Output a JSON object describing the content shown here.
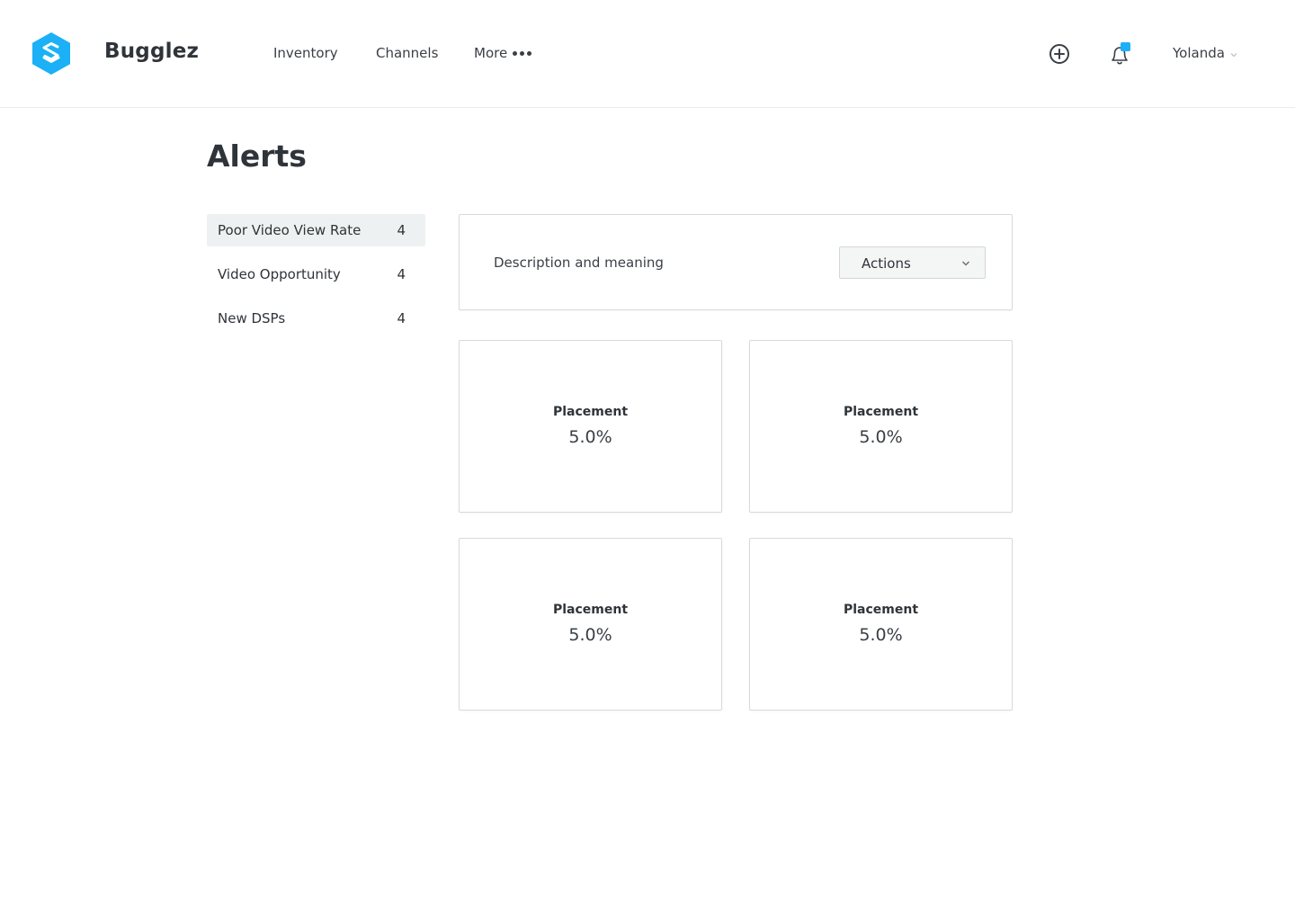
{
  "header": {
    "brand": "Bugglez",
    "nav": {
      "inventory": "Inventory",
      "channels": "Channels",
      "more": "More"
    },
    "user_name": "Yolanda",
    "icons": {
      "logo": "hexagon-logo-icon",
      "add": "plus-circle-icon",
      "notifications": "bell-icon",
      "more": "more-dots-icon",
      "user_menu": "chevron-down-icon"
    },
    "colors": {
      "brand": "#1cb0f6",
      "notification_badge": "#1cb0f6"
    }
  },
  "page": {
    "title": "Alerts"
  },
  "sidebar": {
    "items": [
      {
        "label": "Poor Video View Rate",
        "count": "4",
        "active": true
      },
      {
        "label": "Video Opportunity",
        "count": "4",
        "active": false
      },
      {
        "label": "New DSPs",
        "count": "4",
        "active": false
      }
    ]
  },
  "description": {
    "text": "Description and meaning",
    "actions_label": "Actions"
  },
  "cards": [
    {
      "label": "Placement",
      "value": "5.0%"
    },
    {
      "label": "Placement",
      "value": "5.0%"
    },
    {
      "label": "Placement",
      "value": "5.0%"
    },
    {
      "label": "Placement",
      "value": "5.0%"
    }
  ]
}
